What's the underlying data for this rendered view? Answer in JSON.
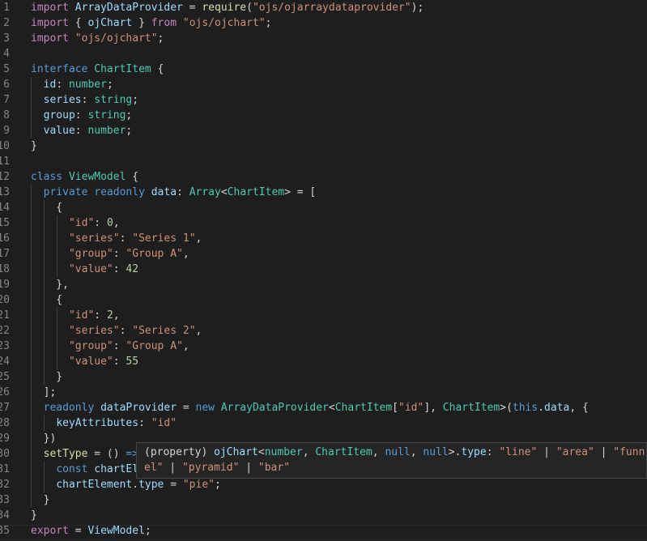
{
  "editor": {
    "lines": [
      {
        "n": "1",
        "tokens": [
          {
            "t": "import ",
            "c": "ctl"
          },
          {
            "t": "ArrayDataProvider",
            "c": "prop"
          },
          {
            "t": " = "
          },
          {
            "t": "require",
            "c": "fn"
          },
          {
            "t": "("
          },
          {
            "t": "\"ojs/ojarraydataprovider\"",
            "c": "str"
          },
          {
            "t": ");"
          }
        ]
      },
      {
        "n": "2",
        "tokens": [
          {
            "t": "import ",
            "c": "ctl"
          },
          {
            "t": "{ "
          },
          {
            "t": "ojChart",
            "c": "prop"
          },
          {
            "t": " } "
          },
          {
            "t": "from ",
            "c": "ctl"
          },
          {
            "t": "\"ojs/ojchart\"",
            "c": "str"
          },
          {
            "t": ";"
          }
        ]
      },
      {
        "n": "3",
        "tokens": [
          {
            "t": "import ",
            "c": "ctl"
          },
          {
            "t": "\"ojs/ojchart\"",
            "c": "str"
          },
          {
            "t": ";"
          }
        ]
      },
      {
        "n": "4",
        "tokens": []
      },
      {
        "n": "5",
        "tokens": [
          {
            "t": "interface ",
            "c": "kw"
          },
          {
            "t": "ChartItem",
            "c": "ty"
          },
          {
            "t": " {"
          }
        ]
      },
      {
        "n": "6",
        "tokens": [
          {
            "t": "  "
          },
          {
            "t": "id",
            "c": "prop"
          },
          {
            "t": ": "
          },
          {
            "t": "number",
            "c": "ty"
          },
          {
            "t": ";"
          }
        ]
      },
      {
        "n": "7",
        "tokens": [
          {
            "t": "  "
          },
          {
            "t": "series",
            "c": "prop"
          },
          {
            "t": ": "
          },
          {
            "t": "string",
            "c": "ty"
          },
          {
            "t": ";"
          }
        ]
      },
      {
        "n": "8",
        "tokens": [
          {
            "t": "  "
          },
          {
            "t": "group",
            "c": "prop"
          },
          {
            "t": ": "
          },
          {
            "t": "string",
            "c": "ty"
          },
          {
            "t": ";"
          }
        ]
      },
      {
        "n": "9",
        "tokens": [
          {
            "t": "  "
          },
          {
            "t": "value",
            "c": "prop"
          },
          {
            "t": ": "
          },
          {
            "t": "number",
            "c": "ty"
          },
          {
            "t": ";"
          }
        ]
      },
      {
        "n": "10",
        "tokens": [
          {
            "t": "}"
          }
        ]
      },
      {
        "n": "11",
        "tokens": []
      },
      {
        "n": "12",
        "tokens": [
          {
            "t": "class ",
            "c": "kw"
          },
          {
            "t": "ViewModel",
            "c": "ty"
          },
          {
            "t": " {"
          }
        ]
      },
      {
        "n": "13",
        "tokens": [
          {
            "t": "  "
          },
          {
            "t": "private ",
            "c": "kw"
          },
          {
            "t": "readonly ",
            "c": "kw"
          },
          {
            "t": "data",
            "c": "prop"
          },
          {
            "t": ": "
          },
          {
            "t": "Array",
            "c": "ty"
          },
          {
            "t": "<"
          },
          {
            "t": "ChartItem",
            "c": "ty"
          },
          {
            "t": "> = ["
          }
        ]
      },
      {
        "n": "14",
        "tokens": [
          {
            "t": "    {"
          }
        ]
      },
      {
        "n": "15",
        "tokens": [
          {
            "t": "      "
          },
          {
            "t": "\"id\"",
            "c": "str"
          },
          {
            "t": ": "
          },
          {
            "t": "0",
            "c": "num"
          },
          {
            "t": ","
          }
        ]
      },
      {
        "n": "16",
        "tokens": [
          {
            "t": "      "
          },
          {
            "t": "\"series\"",
            "c": "str"
          },
          {
            "t": ": "
          },
          {
            "t": "\"Series 1\"",
            "c": "str"
          },
          {
            "t": ","
          }
        ]
      },
      {
        "n": "17",
        "tokens": [
          {
            "t": "      "
          },
          {
            "t": "\"group\"",
            "c": "str"
          },
          {
            "t": ": "
          },
          {
            "t": "\"Group A\"",
            "c": "str"
          },
          {
            "t": ","
          }
        ]
      },
      {
        "n": "18",
        "tokens": [
          {
            "t": "      "
          },
          {
            "t": "\"value\"",
            "c": "str"
          },
          {
            "t": ": "
          },
          {
            "t": "42",
            "c": "num"
          }
        ]
      },
      {
        "n": "19",
        "tokens": [
          {
            "t": "    },"
          }
        ]
      },
      {
        "n": "20",
        "tokens": [
          {
            "t": "    {"
          }
        ]
      },
      {
        "n": "21",
        "tokens": [
          {
            "t": "      "
          },
          {
            "t": "\"id\"",
            "c": "str"
          },
          {
            "t": ": "
          },
          {
            "t": "2",
            "c": "num"
          },
          {
            "t": ","
          }
        ]
      },
      {
        "n": "22",
        "tokens": [
          {
            "t": "      "
          },
          {
            "t": "\"series\"",
            "c": "str"
          },
          {
            "t": ": "
          },
          {
            "t": "\"Series 2\"",
            "c": "str"
          },
          {
            "t": ","
          }
        ]
      },
      {
        "n": "23",
        "tokens": [
          {
            "t": "      "
          },
          {
            "t": "\"group\"",
            "c": "str"
          },
          {
            "t": ": "
          },
          {
            "t": "\"Group A\"",
            "c": "str"
          },
          {
            "t": ","
          }
        ]
      },
      {
        "n": "24",
        "tokens": [
          {
            "t": "      "
          },
          {
            "t": "\"value\"",
            "c": "str"
          },
          {
            "t": ": "
          },
          {
            "t": "55",
            "c": "num"
          }
        ]
      },
      {
        "n": "25",
        "tokens": [
          {
            "t": "    }"
          }
        ]
      },
      {
        "n": "26",
        "tokens": [
          {
            "t": "  ];"
          }
        ]
      },
      {
        "n": "27",
        "tokens": [
          {
            "t": "  "
          },
          {
            "t": "readonly ",
            "c": "kw"
          },
          {
            "t": "dataProvider",
            "c": "prop"
          },
          {
            "t": " = "
          },
          {
            "t": "new ",
            "c": "kw"
          },
          {
            "t": "ArrayDataProvider",
            "c": "ty"
          },
          {
            "t": "<"
          },
          {
            "t": "ChartItem",
            "c": "ty"
          },
          {
            "t": "["
          },
          {
            "t": "\"id\"",
            "c": "str"
          },
          {
            "t": "], "
          },
          {
            "t": "ChartItem",
            "c": "ty"
          },
          {
            "t": ">("
          },
          {
            "t": "this",
            "c": "kw"
          },
          {
            "t": "."
          },
          {
            "t": "data",
            "c": "prop"
          },
          {
            "t": ", {"
          }
        ]
      },
      {
        "n": "28",
        "tokens": [
          {
            "t": "    "
          },
          {
            "t": "keyAttributes",
            "c": "prop"
          },
          {
            "t": ": "
          },
          {
            "t": "\"id\"",
            "c": "str"
          }
        ]
      },
      {
        "n": "29",
        "tokens": [
          {
            "t": "  })"
          }
        ]
      },
      {
        "n": "30",
        "tokens": [
          {
            "t": "  "
          },
          {
            "t": "setType",
            "c": "fn"
          },
          {
            "t": " = () "
          },
          {
            "t": "=>",
            "c": "kw"
          }
        ]
      },
      {
        "n": "31",
        "tokens": [
          {
            "t": "    "
          },
          {
            "t": "const ",
            "c": "kw"
          },
          {
            "t": "chartEl",
            "c": "prop"
          }
        ]
      },
      {
        "n": "32",
        "tokens": [
          {
            "t": "    "
          },
          {
            "t": "chartElement",
            "c": "prop"
          },
          {
            "t": "."
          },
          {
            "t": "type",
            "c": "prop"
          },
          {
            "t": " = "
          },
          {
            "t": "\"pie\"",
            "c": "str"
          },
          {
            "t": ";"
          }
        ]
      },
      {
        "n": "33",
        "tokens": [
          {
            "t": "  }"
          }
        ]
      },
      {
        "n": "34",
        "tokens": [
          {
            "t": "}"
          }
        ]
      },
      {
        "n": "35",
        "tokens": [
          {
            "t": "export ",
            "c": "ctl"
          },
          {
            "t": "= "
          },
          {
            "t": "ViewModel",
            "c": "prop"
          },
          {
            "t": ";"
          }
        ]
      }
    ]
  },
  "hover": {
    "lines": [
      [
        {
          "t": "(property) "
        },
        {
          "t": "ojChart",
          "c": "prop"
        },
        {
          "t": "<"
        },
        {
          "t": "number",
          "c": "ty"
        },
        {
          "t": ", "
        },
        {
          "t": "ChartItem",
          "c": "ty"
        },
        {
          "t": ", "
        },
        {
          "t": "null",
          "c": "kw"
        },
        {
          "t": ", "
        },
        {
          "t": "null",
          "c": "kw"
        },
        {
          "t": ">."
        },
        {
          "t": "type",
          "c": "prop"
        },
        {
          "t": ": "
        },
        {
          "t": "\"line\"",
          "c": "str"
        },
        {
          "t": " | "
        },
        {
          "t": "\"area\"",
          "c": "str"
        },
        {
          "t": " | "
        },
        {
          "t": "\"funn",
          "c": "str"
        }
      ],
      [
        {
          "t": "el\"",
          "c": "str"
        },
        {
          "t": " | "
        },
        {
          "t": "\"pyramid\"",
          "c": "str"
        },
        {
          "t": " | "
        },
        {
          "t": "\"bar\"",
          "c": "str"
        }
      ]
    ]
  }
}
